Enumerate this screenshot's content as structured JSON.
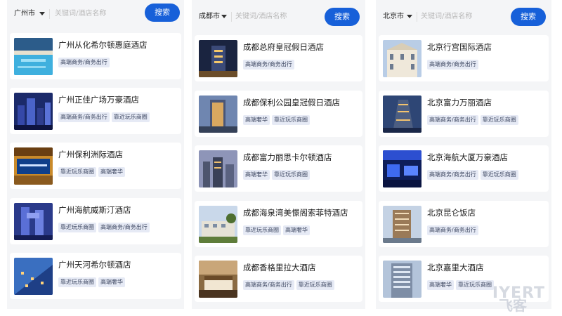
{
  "search_label": "搜索",
  "placeholder": "关键词/酒店名称",
  "columns": [
    {
      "city": "广州市",
      "hotels": [
        {
          "name": "广州从化希尔顿惠庭酒店",
          "tags": [
            "高端商务/商务出行"
          ],
          "image": "resort-pool-icon"
        },
        {
          "name": "广州正佳广场万豪酒店",
          "tags": [
            "高端商务/商务出行",
            "靠近玩乐商圈"
          ],
          "image": "city-night-icon"
        },
        {
          "name": "广州保利洲际酒店",
          "tags": [
            "靠近玩乐商圈",
            "高端奢华"
          ],
          "image": "lobby-icon"
        },
        {
          "name": "广州海航威斯汀酒店",
          "tags": [
            "靠近玩乐商圈",
            "高端商务/商务出行"
          ],
          "image": "tower-icon"
        },
        {
          "name": "广州天河希尔顿酒店",
          "tags": [
            "靠近玩乐商圈",
            "高端奢华"
          ],
          "image": "facade-icon"
        }
      ]
    },
    {
      "city": "成都市",
      "hotels": [
        {
          "name": "成都总府皇冠假日酒店",
          "tags": [
            "高端商务/商务出行"
          ],
          "image": "tower-night-icon"
        },
        {
          "name": "成都保利公园皇冠假日酒店",
          "tags": [
            "高端奢华",
            "靠近玩乐商圈"
          ],
          "image": "tower-dusk-icon"
        },
        {
          "name": "成都富力丽思卡尔顿酒店",
          "tags": [
            "高端奢华",
            "靠近玩乐商圈"
          ],
          "image": "city-dusk-icon"
        },
        {
          "name": "成都海泉湾美憬阁索菲特酒店",
          "tags": [
            "靠近玩乐商圈",
            "高端奢华"
          ],
          "image": "lowrise-icon"
        },
        {
          "name": "成都香格里拉大酒店",
          "tags": [
            "高端商务/商务出行",
            "靠近玩乐商圈"
          ],
          "image": "room-icon"
        }
      ]
    },
    {
      "city": "北京市",
      "hotels": [
        {
          "name": "北京行宫国际酒店",
          "tags": [
            "高端商务/商务出行"
          ],
          "image": "classic-building-icon"
        },
        {
          "name": "北京富力万丽酒店",
          "tags": [
            "高端商务/商务出行",
            "靠近玩乐商圈"
          ],
          "image": "tower-blue-icon"
        },
        {
          "name": "北京海航大厦万豪酒店",
          "tags": [
            "高端商务/商务出行",
            "靠近玩乐商圈"
          ],
          "image": "blue-interior-icon"
        },
        {
          "name": "北京昆仑饭店",
          "tags": [
            "高端商务/商务出行"
          ],
          "image": "highrise-icon"
        },
        {
          "name": "北京嘉里大酒店",
          "tags": [
            "高端奢华",
            "靠近玩乐商圈"
          ],
          "image": "glass-tower-icon"
        }
      ]
    }
  ],
  "watermark": {
    "line1": "IYERT",
    "line2": "飞客"
  }
}
